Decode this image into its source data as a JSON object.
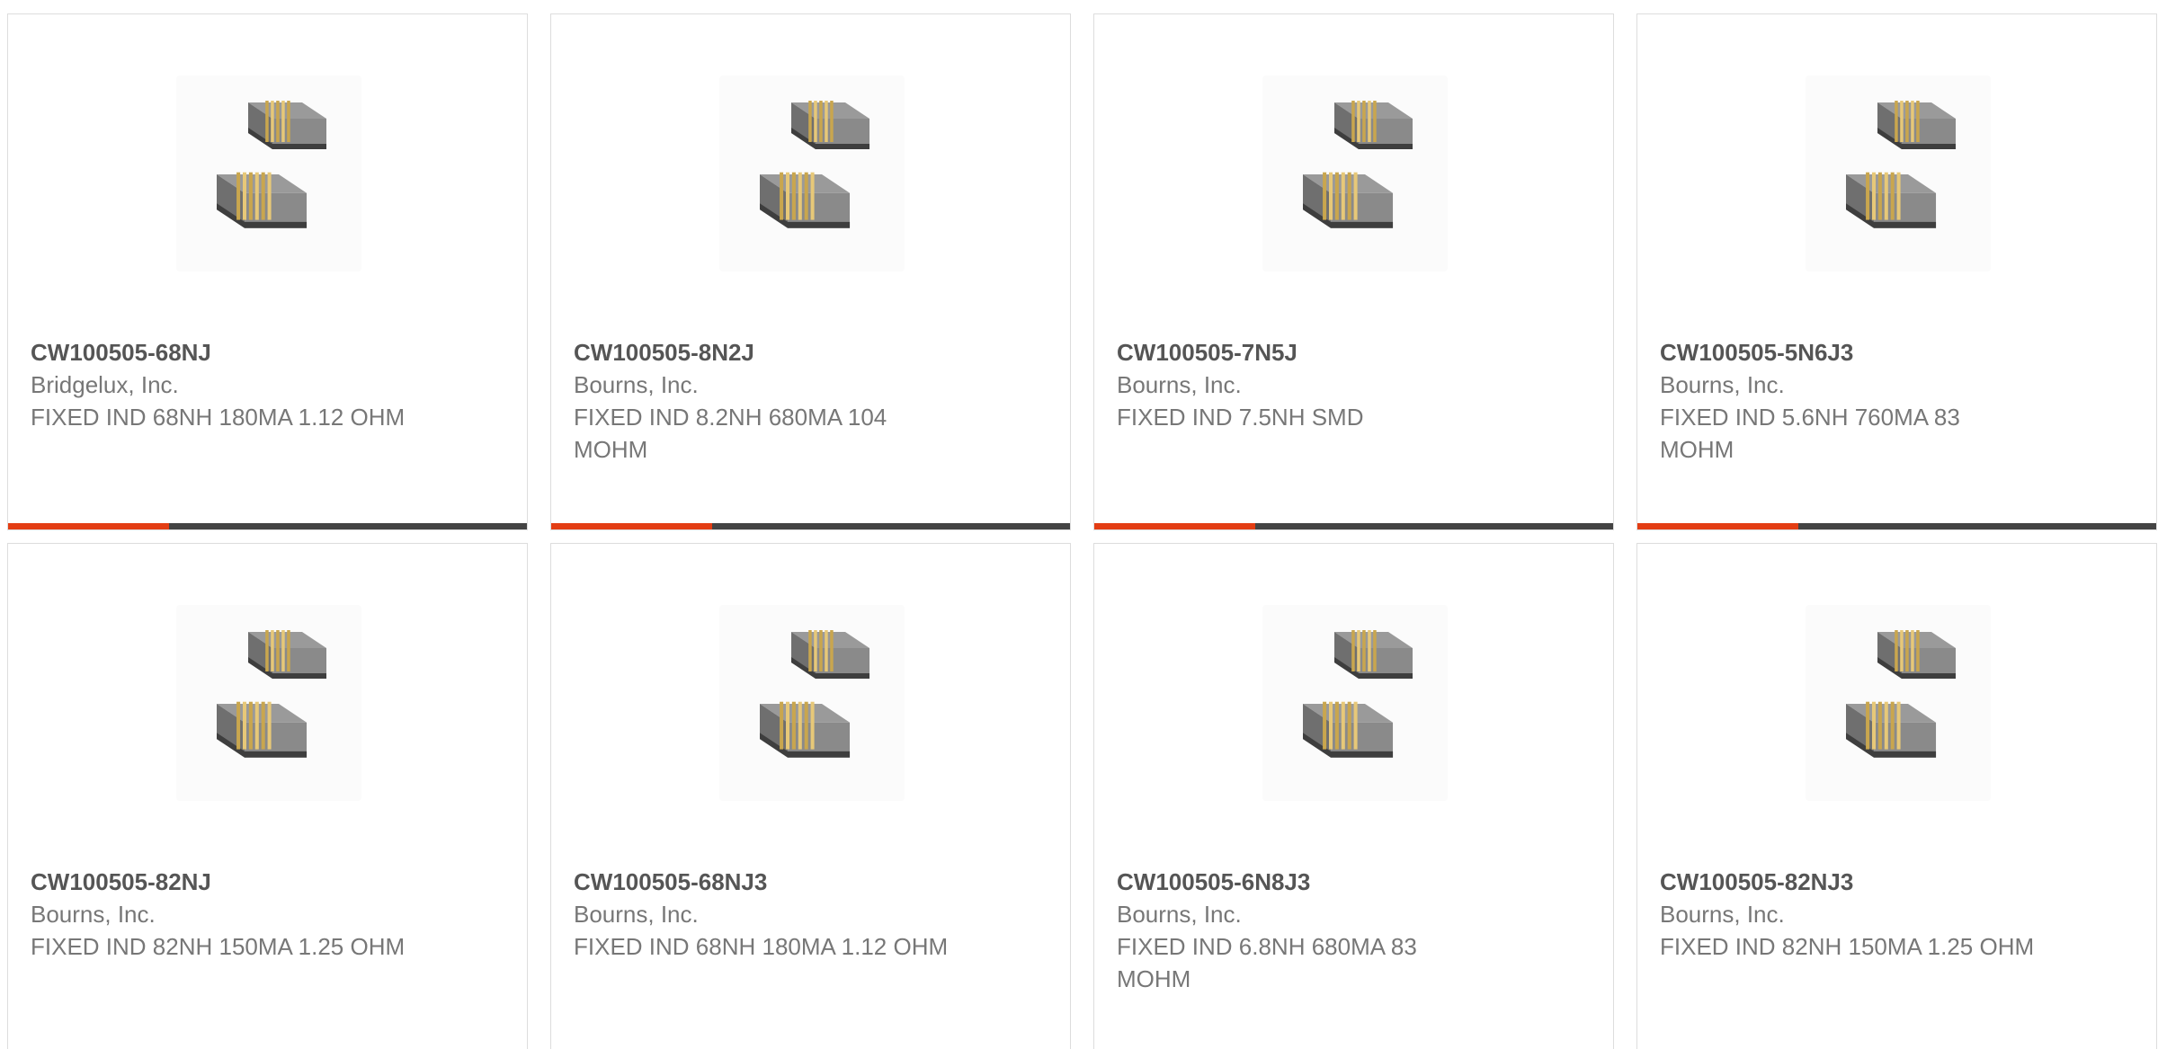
{
  "products": [
    {
      "part_number": "CW100505-68NJ",
      "manufacturer": "Bridgelux, Inc.",
      "description": "FIXED IND 68NH 180MA 1.12 OHM",
      "image_icon": "inductor-image"
    },
    {
      "part_number": "CW100505-8N2J",
      "manufacturer": "Bourns, Inc.",
      "description": "FIXED IND 8.2NH 680MA 104 MOHM",
      "image_icon": "inductor-image"
    },
    {
      "part_number": "CW100505-7N5J",
      "manufacturer": "Bourns, Inc.",
      "description": "FIXED IND 7.5NH SMD",
      "image_icon": "inductor-image"
    },
    {
      "part_number": "CW100505-5N6J3",
      "manufacturer": "Bourns, Inc.",
      "description": "FIXED IND 5.6NH 760MA 83 MOHM",
      "image_icon": "inductor-image"
    },
    {
      "part_number": "CW100505-82NJ",
      "manufacturer": "Bourns, Inc.",
      "description": "FIXED IND 82NH 150MA 1.25 OHM",
      "image_icon": "inductor-image"
    },
    {
      "part_number": "CW100505-68NJ3",
      "manufacturer": "Bourns, Inc.",
      "description": "FIXED IND 68NH 180MA 1.12 OHM",
      "image_icon": "inductor-image"
    },
    {
      "part_number": "CW100505-6N8J3",
      "manufacturer": "Bourns, Inc.",
      "description": "FIXED IND 6.8NH 680MA 83 MOHM",
      "image_icon": "inductor-image"
    },
    {
      "part_number": "CW100505-82NJ3",
      "manufacturer": "Bourns, Inc.",
      "description": "FIXED IND 82NH 150MA 1.25 OHM",
      "image_icon": "inductor-image"
    }
  ],
  "colors": {
    "accent": "#e33d13",
    "bar": "#444444",
    "part_number": "#555555",
    "text": "#777777"
  },
  "card_progress_fraction": 0.31
}
